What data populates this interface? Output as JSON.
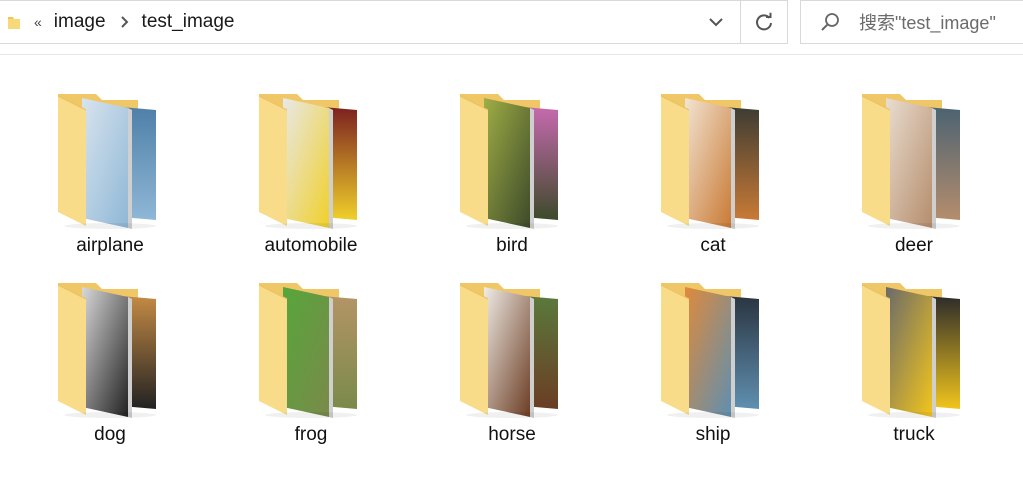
{
  "addressbar": {
    "overflow_label": "«",
    "breadcrumb": [
      "image",
      "test_image"
    ]
  },
  "search": {
    "placeholder": "搜索\"test_image\""
  },
  "folders": [
    {
      "label": "airplane",
      "colors": [
        "#8fb7d6",
        "#d8e4ee",
        "#4e7fa8"
      ]
    },
    {
      "label": "automobile",
      "colors": [
        "#f0d02a",
        "#e8e8e8",
        "#7a1f1f"
      ]
    },
    {
      "label": "bird",
      "colors": [
        "#3d4a2a",
        "#9fae45",
        "#c86ab0"
      ]
    },
    {
      "label": "cat",
      "colors": [
        "#c97a35",
        "#f2e4d2",
        "#3b3b34"
      ]
    },
    {
      "label": "deer",
      "colors": [
        "#b58d6c",
        "#e9ddd0",
        "#4a6272"
      ]
    },
    {
      "label": "dog",
      "colors": [
        "#222",
        "#d9d9d9",
        "#c58b45"
      ]
    },
    {
      "label": "frog",
      "colors": [
        "#7a8a4a",
        "#56a63b",
        "#b49466"
      ]
    },
    {
      "label": "horse",
      "colors": [
        "#6b3d24",
        "#f0ece6",
        "#5a7a3d"
      ]
    },
    {
      "label": "ship",
      "colors": [
        "#5f8fb0",
        "#e08a3a",
        "#2a3440"
      ]
    },
    {
      "label": "truck",
      "colors": [
        "#f2c51c",
        "#6a6a6a",
        "#2a2a2a"
      ]
    }
  ]
}
